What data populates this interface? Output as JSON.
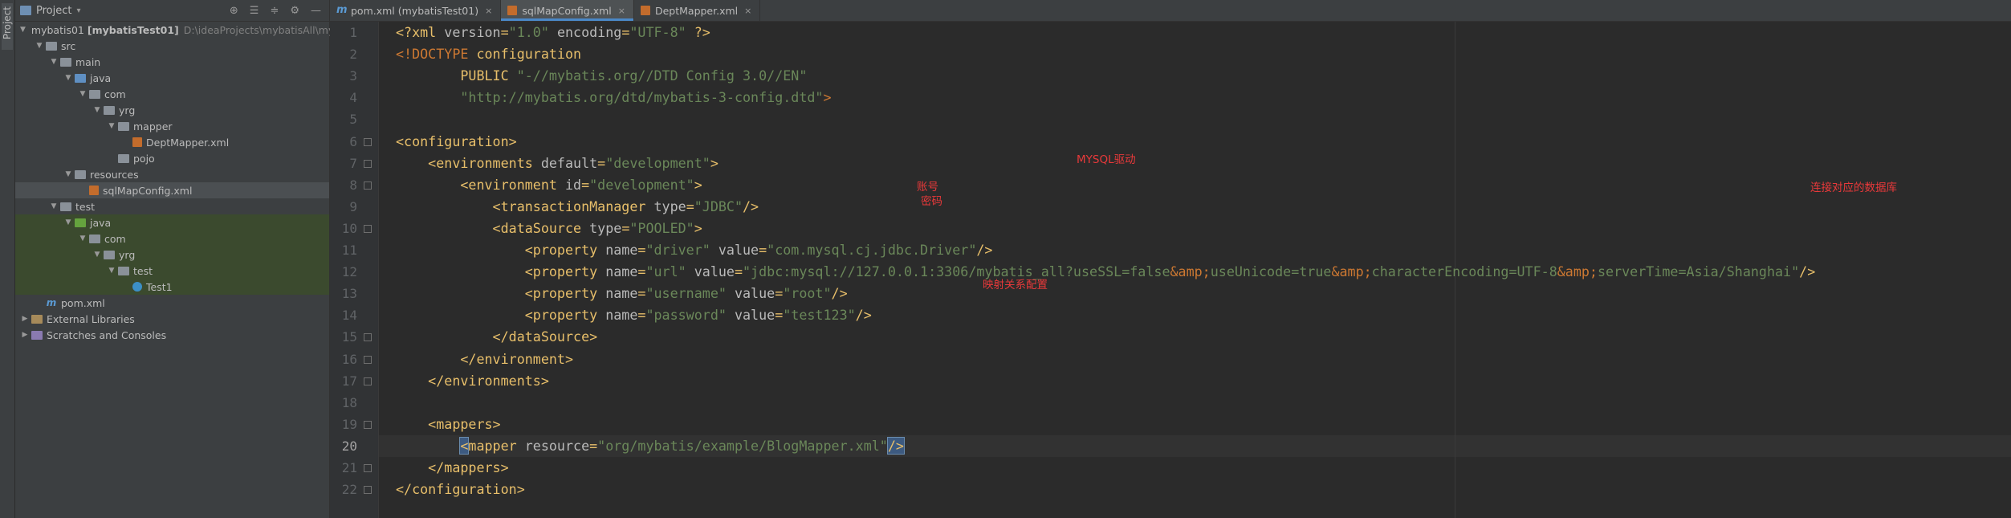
{
  "side_strip": {
    "label": "Project"
  },
  "project_panel": {
    "title": "Project",
    "tools": [
      "target-icon",
      "expand-all-icon",
      "collapse-all-icon",
      "gear-icon",
      "minimize-icon"
    ],
    "tree": [
      {
        "label": "mybatis01",
        "bold": "[mybatisTest01]",
        "path": "D:\\ideaProjects\\mybatisAll\\myb",
        "depth": 0,
        "arrow": "open",
        "icon": "module"
      },
      {
        "label": "src",
        "depth": 1,
        "arrow": "open",
        "icon": "folder"
      },
      {
        "label": "main",
        "depth": 2,
        "arrow": "open",
        "icon": "folder"
      },
      {
        "label": "java",
        "depth": 3,
        "arrow": "open",
        "icon": "src"
      },
      {
        "label": "com",
        "depth": 4,
        "arrow": "open",
        "icon": "package"
      },
      {
        "label": "yrg",
        "depth": 5,
        "arrow": "open",
        "icon": "package"
      },
      {
        "label": "mapper",
        "depth": 6,
        "arrow": "open",
        "icon": "package"
      },
      {
        "label": "DeptMapper.xml",
        "depth": 7,
        "arrow": "none",
        "icon": "xml"
      },
      {
        "label": "pojo",
        "depth": 6,
        "arrow": "none",
        "icon": "package"
      },
      {
        "label": "resources",
        "depth": 3,
        "arrow": "open",
        "icon": "resources"
      },
      {
        "label": "sqlMapConfig.xml",
        "depth": 4,
        "arrow": "none",
        "icon": "xml",
        "selected": true
      },
      {
        "label": "test",
        "depth": 2,
        "arrow": "open",
        "icon": "folder"
      },
      {
        "label": "java",
        "depth": 3,
        "arrow": "open",
        "icon": "testsrc",
        "test": true
      },
      {
        "label": "com",
        "depth": 4,
        "arrow": "open",
        "icon": "package",
        "test": true
      },
      {
        "label": "yrg",
        "depth": 5,
        "arrow": "open",
        "icon": "package",
        "test": true
      },
      {
        "label": "test",
        "depth": 6,
        "arrow": "open",
        "icon": "package",
        "test": true
      },
      {
        "label": "Test1",
        "depth": 7,
        "arrow": "none",
        "icon": "java",
        "test": true
      },
      {
        "label": "pom.xml",
        "depth": 1,
        "arrow": "none",
        "icon": "maven"
      },
      {
        "label": "External Libraries",
        "depth": 0,
        "arrow": "closed",
        "icon": "library"
      },
      {
        "label": "Scratches and Consoles",
        "depth": 0,
        "arrow": "closed",
        "icon": "scratch"
      }
    ]
  },
  "tabs": [
    {
      "label": "pom.xml (mybatisTest01)",
      "icon": "m",
      "active": false
    },
    {
      "label": "sqlMapConfig.xml",
      "icon": "xml",
      "active": true
    },
    {
      "label": "DeptMapper.xml",
      "icon": "xml",
      "active": false
    }
  ],
  "editor": {
    "current_line": 20,
    "lines": [
      {
        "n": "1",
        "parts": [
          [
            "t",
            "<?xml "
          ],
          [
            "a",
            "version"
          ],
          [
            "t",
            "="
          ],
          [
            "s",
            "\"1.0\""
          ],
          [
            "t",
            " "
          ],
          [
            "a",
            "encoding"
          ],
          [
            "t",
            "="
          ],
          [
            "s",
            "\"UTF-8\""
          ],
          [
            "t",
            " ?>"
          ]
        ]
      },
      {
        "n": "2",
        "parts": [
          [
            "dt",
            "<!DOCTYPE "
          ],
          [
            "p",
            "configuration"
          ]
        ]
      },
      {
        "n": "3",
        "parts": [
          [
            "p",
            "        PUBLIC "
          ],
          [
            "s",
            "\"-//mybatis.org//DTD Config 3.0//EN\""
          ]
        ]
      },
      {
        "n": "4",
        "parts": [
          [
            "s",
            "        \"http://mybatis.org/dtd/mybatis-3-config.dtd\""
          ],
          [
            "dt",
            ">"
          ]
        ]
      },
      {
        "n": "5",
        "parts": []
      },
      {
        "n": "6",
        "parts": [
          [
            "t",
            "<configuration>"
          ]
        ]
      },
      {
        "n": "7",
        "parts": [
          [
            "t",
            "    <environments "
          ],
          [
            "a",
            "default"
          ],
          [
            "t",
            "="
          ],
          [
            "s",
            "\"development\""
          ],
          [
            "t",
            ">"
          ]
        ]
      },
      {
        "n": "8",
        "parts": [
          [
            "t",
            "        <environment "
          ],
          [
            "a",
            "id"
          ],
          [
            "t",
            "="
          ],
          [
            "s",
            "\"development\""
          ],
          [
            "t",
            ">"
          ]
        ]
      },
      {
        "n": "9",
        "parts": [
          [
            "t",
            "            <transactionManager "
          ],
          [
            "a",
            "type"
          ],
          [
            "t",
            "="
          ],
          [
            "s",
            "\"JDBC\""
          ],
          [
            "t",
            "/>"
          ]
        ]
      },
      {
        "n": "10",
        "parts": [
          [
            "t",
            "            <dataSource "
          ],
          [
            "a",
            "type"
          ],
          [
            "t",
            "="
          ],
          [
            "s",
            "\"POOLED\""
          ],
          [
            "t",
            ">"
          ]
        ]
      },
      {
        "n": "11",
        "parts": [
          [
            "t",
            "                <property "
          ],
          [
            "a",
            "name"
          ],
          [
            "t",
            "="
          ],
          [
            "s",
            "\"driver\""
          ],
          [
            "t",
            " "
          ],
          [
            "a",
            "value"
          ],
          [
            "t",
            "="
          ],
          [
            "s",
            "\"com.mysql.cj.jdbc.Driver\""
          ],
          [
            "t",
            "/>"
          ]
        ]
      },
      {
        "n": "12",
        "parts": [
          [
            "t",
            "                <property "
          ],
          [
            "a",
            "name"
          ],
          [
            "t",
            "="
          ],
          [
            "s",
            "\"url\""
          ],
          [
            "t",
            " "
          ],
          [
            "a",
            "value"
          ],
          [
            "t",
            "="
          ],
          [
            "s",
            "\"jdbc:mysql://127.0.0.1:3306/mybatis_all?useSSL=false"
          ],
          [
            "e",
            "&amp;"
          ],
          [
            "s",
            "useUnicode=true"
          ],
          [
            "e",
            "&amp;"
          ],
          [
            "s",
            "characterEncoding=UTF-8"
          ],
          [
            "e",
            "&amp;"
          ],
          [
            "s",
            "serverTime=Asia/Shanghai\""
          ],
          [
            "t",
            "/>"
          ]
        ]
      },
      {
        "n": "13",
        "parts": [
          [
            "t",
            "                <property "
          ],
          [
            "a",
            "name"
          ],
          [
            "t",
            "="
          ],
          [
            "s",
            "\"username\""
          ],
          [
            "t",
            " "
          ],
          [
            "a",
            "value"
          ],
          [
            "t",
            "="
          ],
          [
            "s",
            "\"root\""
          ],
          [
            "t",
            "/>"
          ]
        ]
      },
      {
        "n": "14",
        "parts": [
          [
            "t",
            "                <property "
          ],
          [
            "a",
            "name"
          ],
          [
            "t",
            "="
          ],
          [
            "s",
            "\"password\""
          ],
          [
            "t",
            " "
          ],
          [
            "a",
            "value"
          ],
          [
            "t",
            "="
          ],
          [
            "s",
            "\"test123\""
          ],
          [
            "t",
            "/>"
          ]
        ]
      },
      {
        "n": "15",
        "parts": [
          [
            "t",
            "            </dataSource>"
          ]
        ]
      },
      {
        "n": "16",
        "parts": [
          [
            "t",
            "        </environment>"
          ]
        ]
      },
      {
        "n": "17",
        "parts": [
          [
            "t",
            "    </environments>"
          ]
        ]
      },
      {
        "n": "18",
        "parts": []
      },
      {
        "n": "19",
        "parts": [
          [
            "t",
            "    <mappers>"
          ]
        ]
      },
      {
        "n": "20",
        "parts": [
          [
            "t",
            "        "
          ],
          [
            "tc",
            "<"
          ],
          [
            "t",
            "mapper "
          ],
          [
            "a",
            "resource"
          ],
          [
            "t",
            "="
          ],
          [
            "s",
            "\"org/mybatis/example/BlogMapper.xml\""
          ],
          [
            "tc",
            "/>"
          ]
        ]
      },
      {
        "n": "21",
        "parts": [
          [
            "t",
            "    </mappers>"
          ]
        ]
      },
      {
        "n": "22",
        "parts": [
          [
            "t",
            "</configuration>"
          ]
        ]
      }
    ],
    "fold_lines": [
      6,
      7,
      8,
      10,
      15,
      16,
      17,
      19,
      21,
      22
    ],
    "annotations": {
      "driver": "MYSQL驱动",
      "username": "账号",
      "password": "密码",
      "url": "连接对应的数据库",
      "mapper": "映射关系配置"
    }
  }
}
